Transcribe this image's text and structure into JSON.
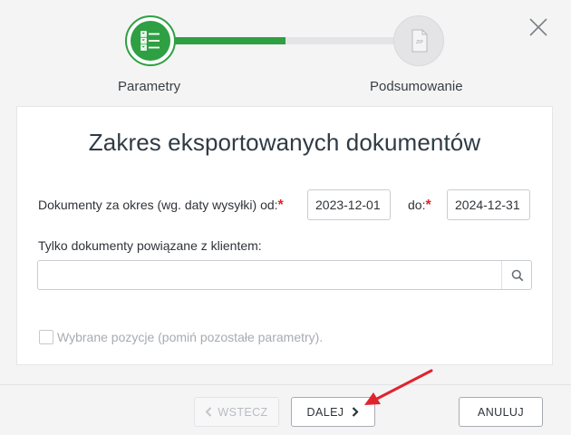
{
  "stepper": {
    "steps": [
      {
        "label": "Parametry",
        "icon": "checklist-icon",
        "state": "active"
      },
      {
        "label": "Podsumowanie",
        "icon": "zip-file-icon",
        "state": "inactive"
      }
    ],
    "progress": 0.5,
    "zip_text": "ZIP"
  },
  "close": {
    "icon": "close-icon"
  },
  "form": {
    "title": "Zakres eksportowanych dokumentów",
    "range_label": "Dokumenty za okres (wg. daty wysyłki)  od:",
    "required_mark": "*",
    "date_from": "2023-12-01",
    "to_label": "do:",
    "date_to": "2024-12-31",
    "client_label": "Tylko dokumenty powiązane z klientem:",
    "client_value": "",
    "selected_only_label": "Wybrane pozycje (pomiń pozostałe parametry).",
    "selected_only_checked": false
  },
  "footer": {
    "back_label": "WSTECZ",
    "next_label": "DALEJ",
    "cancel_label": "ANULUJ"
  },
  "colors": {
    "accent": "#2ea043",
    "required": "#e0242e",
    "annotation_arrow": "#e0242e"
  }
}
